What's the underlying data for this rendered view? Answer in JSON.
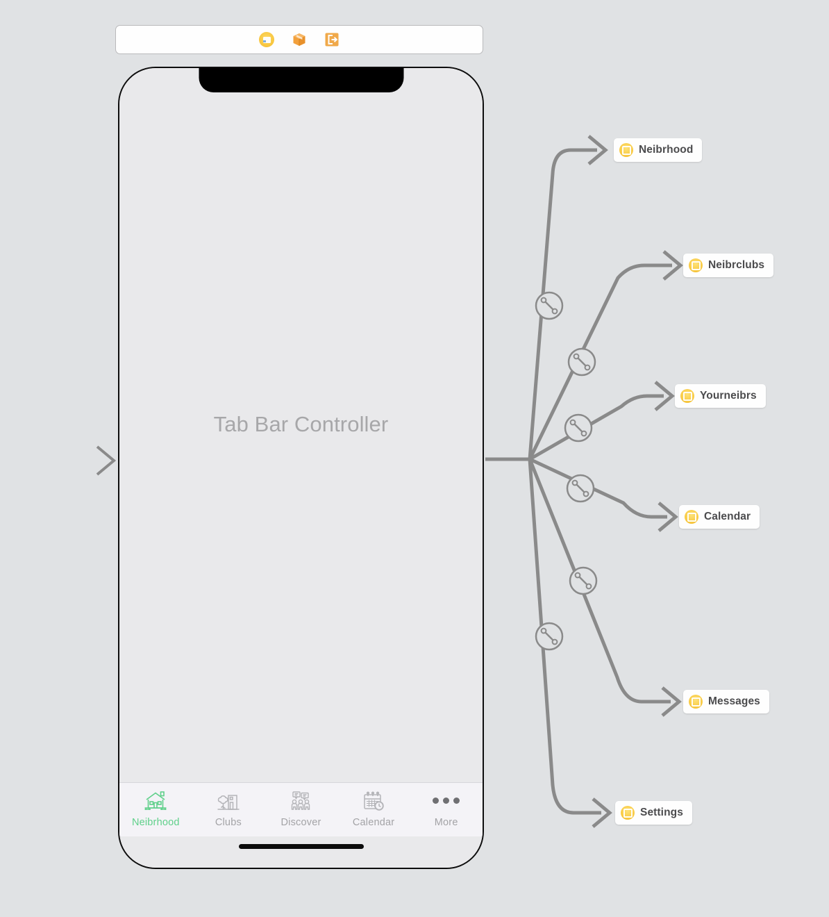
{
  "app": {
    "canvas_background": "#e0e2e4",
    "accent_yellow": "#f9cb45",
    "accent_green": "#5fd08a",
    "wire_color": "#8a8a8a"
  },
  "scene_dock": {
    "icons": [
      {
        "name": "view-controller-icon",
        "glyph": "view-controller"
      },
      {
        "name": "cube-icon",
        "glyph": "3d-cube"
      },
      {
        "name": "exit-icon",
        "glyph": "exit-segue"
      }
    ]
  },
  "phone": {
    "scene_title": "Tab Bar Controller",
    "tabbar": {
      "tabs": [
        {
          "label": "Neibrhood",
          "icon": "house-icon",
          "active": true
        },
        {
          "label": "Clubs",
          "icon": "tree-shop-icon",
          "active": false
        },
        {
          "label": "Discover",
          "icon": "people-chat-icon",
          "active": false
        },
        {
          "label": "Calendar",
          "icon": "calendar-clock-icon",
          "active": false
        },
        {
          "label": "More",
          "icon": "ellipsis-icon",
          "active": false
        }
      ]
    }
  },
  "destinations": [
    {
      "label": "Neibrhood",
      "icon": "view-controller-icon"
    },
    {
      "label": "Neibrclubs",
      "icon": "view-controller-icon"
    },
    {
      "label": "Yourneibrs",
      "icon": "view-controller-icon"
    },
    {
      "label": "Calendar",
      "icon": "view-controller-icon"
    },
    {
      "label": "Messages",
      "icon": "view-controller-icon"
    },
    {
      "label": "Settings",
      "icon": "view-controller-icon"
    }
  ],
  "relationship_badges": [
    {
      "name": "relationship-segue-badge",
      "glyph": "relationship"
    },
    {
      "name": "relationship-segue-badge",
      "glyph": "relationship"
    },
    {
      "name": "relationship-segue-badge",
      "glyph": "relationship"
    },
    {
      "name": "relationship-segue-badge",
      "glyph": "relationship"
    },
    {
      "name": "relationship-segue-badge",
      "glyph": "relationship"
    },
    {
      "name": "relationship-segue-badge",
      "glyph": "relationship"
    }
  ],
  "entry_point": {
    "name": "storyboard-entry-arrow",
    "label": ""
  }
}
